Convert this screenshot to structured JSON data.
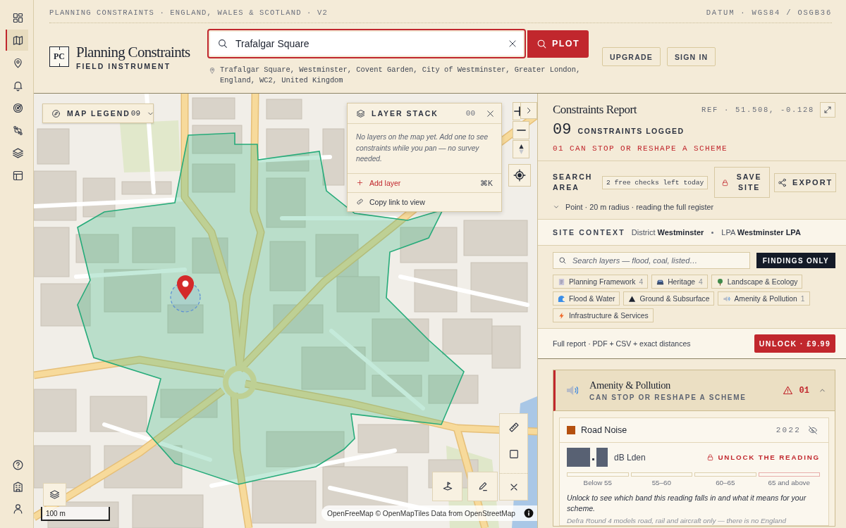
{
  "rail": {
    "items": [
      {
        "selected": false
      },
      {
        "selected": true
      },
      {
        "selected": false
      },
      {
        "selected": false
      },
      {
        "selected": false
      },
      {
        "selected": false
      },
      {
        "selected": false
      },
      {
        "selected": false
      }
    ]
  },
  "header": {
    "kicker": "PLANNING CONSTRAINTS · ENGLAND, WALES & SCOTLAND · V2",
    "datum": "DATUM · WGS84 / OSGB36",
    "logo_mark": "PC",
    "brand": "Planning Constraints",
    "tagline": "FIELD INSTRUMENT",
    "search": {
      "value": "Trafalgar Square",
      "focused": true,
      "button": "PLOT"
    },
    "address": "Trafalgar Square, Westminster, Covent Garden, City of Westminster, Greater London, England, WC2, United Kingdom",
    "buttons": [
      "UPGRADE",
      "SIGN IN"
    ]
  },
  "map": {
    "legend": {
      "label": "MAP LEGEND",
      "count": "09"
    },
    "layer_stack": {
      "title": "LAYER STACK",
      "count": "00",
      "empty_text": "No layers on the map yet. Add one to see constraints while you pan — no survey needed.",
      "actions": [
        {
          "kind": "add",
          "label": "Add layer",
          "shortcut": "⌘K"
        },
        {
          "kind": "link",
          "label": "Copy link to view"
        }
      ]
    },
    "scale": "100 m",
    "attribution": "OpenFreeMap © OpenMapTiles Data from OpenStreetMap"
  },
  "report": {
    "title": "Constraints Report",
    "ref": "REF · 51.508, -0.128",
    "count": "09",
    "count_label": "CONSTRAINTS LOGGED",
    "critical": "01 CAN STOP OR RESHAPE A SCHEME",
    "search_area": {
      "label": "SEARCH AREA",
      "free_checks": "2 free checks left today",
      "save": "SAVE SITE",
      "export": "EXPORT",
      "detail": "Point · 20 m radius · reading the full register"
    },
    "site_context": {
      "label": "SITE CONTEXT",
      "items": [
        "District **Westminster**",
        "LPA **Westminster LPA**"
      ]
    },
    "layer_search": {
      "placeholder": "Search layers — flood, coal, listed…",
      "filter": "FINDINGS ONLY"
    },
    "chips": [
      {
        "label": "Planning Framework",
        "count": "4"
      },
      {
        "label": "Heritage",
        "count": "4"
      },
      {
        "label": "Landscape & Ecology"
      },
      {
        "label": "Flood & Water"
      },
      {
        "label": "Ground & Subsurface"
      },
      {
        "label": "Amenity & Pollution",
        "count": "1"
      },
      {
        "label": "Infrastructure & Services"
      }
    ],
    "unlock": {
      "text": "Full report · PDF + CSV + exact distances",
      "button": "UNLOCK · £9.99"
    },
    "categories": [
      {
        "title": "Amenity & Pollution",
        "subtitle": "CAN STOP OR RESHAPE A SCHEME",
        "count": "01",
        "expanded": true,
        "findings": [
          {
            "name": "Road Noise",
            "color": "#b4500f",
            "year": "2022",
            "unit": "dB Lden",
            "unlock": "UNLOCK THE READING",
            "bands": [
              {
                "label": "Below 55",
                "critical": false
              },
              {
                "label": "55–60",
                "critical": false
              },
              {
                "label": "60–65",
                "critical": false
              },
              {
                "label": "65 and above",
                "critical": true
              }
            ],
            "note": "Unlock to see which band this reading falls in and what it means for your scheme.",
            "source": "Defra Round 4 models road, rail and aircraft only — there is no England"
          }
        ]
      }
    ]
  }
}
